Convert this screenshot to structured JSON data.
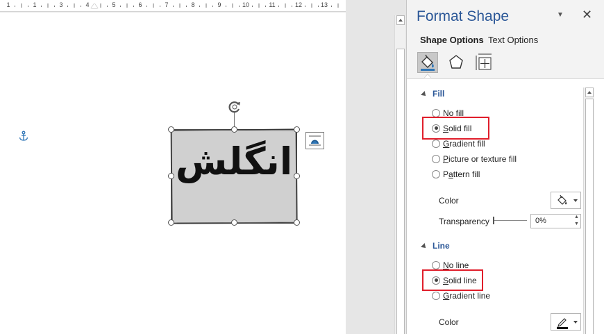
{
  "ruler": {
    "numbers": [
      "1",
      "1",
      "2",
      "3",
      "4",
      "5",
      "6",
      "7",
      "8",
      "9",
      "10",
      "11",
      "12",
      "13"
    ]
  },
  "document": {
    "shape_text": "انگلش"
  },
  "pane": {
    "title": "Format Shape",
    "tabs": [
      "Shape Options",
      "Text Options"
    ],
    "categories": [
      "fill-line-icon",
      "effects-icon",
      "size-properties-icon"
    ],
    "fill": {
      "heading": "Fill",
      "options": [
        {
          "label": "No fill",
          "underline": "N",
          "selected": false
        },
        {
          "label": "Solid fill",
          "underline": "S",
          "selected": true
        },
        {
          "label": "Gradient fill",
          "underline": "G",
          "selected": false
        },
        {
          "label": "Picture or texture fill",
          "underline": "P",
          "selected": false
        },
        {
          "label": "Pattern fill",
          "underline": "A",
          "selected": false
        }
      ],
      "color_label": "Color",
      "transparency_label": "Transparency",
      "transparency_value": "0%"
    },
    "line": {
      "heading": "Line",
      "options": [
        {
          "label": "No line",
          "underline": "N",
          "selected": false
        },
        {
          "label": "Solid line",
          "underline": "S",
          "selected": true
        },
        {
          "label": "Gradient line",
          "underline": "G",
          "selected": false
        }
      ],
      "color_label": "Color"
    }
  },
  "colors": {
    "accent": "#2b5797",
    "highlight": "#e01e2b",
    "shape_fill": "#d0d0d0"
  }
}
